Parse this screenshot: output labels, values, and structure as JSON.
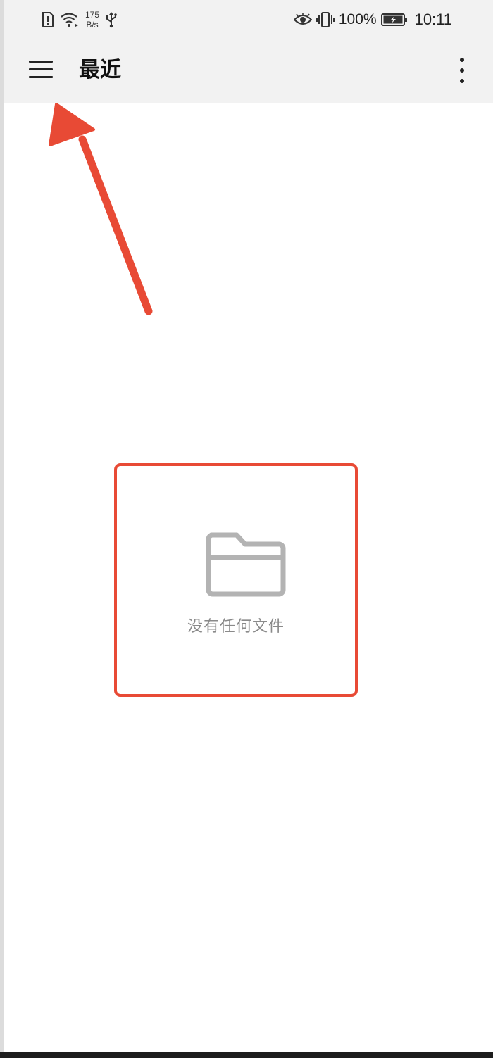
{
  "status_bar": {
    "net_speed_value": "175",
    "net_speed_unit": "B/s",
    "battery": "100%",
    "time": "10:11",
    "icons": [
      "sim-alert-icon",
      "wifi-icon",
      "usb-icon",
      "eye-icon",
      "vibrate-icon",
      "battery-charging-icon"
    ]
  },
  "app_bar": {
    "title": "最近",
    "menu_icon": "hamburger-menu-icon",
    "overflow_icon": "more-vertical-icon"
  },
  "empty_state": {
    "icon": "folder-icon",
    "message": "没有任何文件"
  },
  "colors": {
    "annotation": "#e84a35",
    "app_bar_bg": "#f2f2f2",
    "empty_icon": "#b3b3b3",
    "empty_text": "#8a8a8a"
  }
}
